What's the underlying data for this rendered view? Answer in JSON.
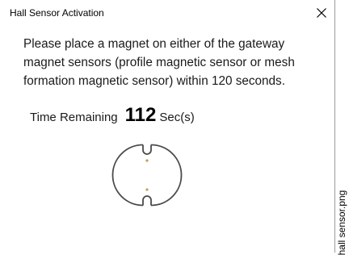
{
  "dialog": {
    "title": "Hall Sensor Activation",
    "close_icon": "close-icon",
    "message": "Please place a magnet on either of the gateway magnet sensors (profile magnetic sensor or mesh formation magnetic sensor) within 120 seconds.",
    "timer": {
      "label": "Time Remaining",
      "value": "112",
      "unit": "Sec(s)"
    },
    "illustration": "hall-sensor-icon"
  },
  "watermark": {
    "text": "hall sensor.png"
  },
  "colors": {
    "background": "#ffffff",
    "text": "#000000",
    "sensor_stroke": "#4a4a4a",
    "sensor_dot": "#b9a15a",
    "border": "#9a9a9a"
  }
}
